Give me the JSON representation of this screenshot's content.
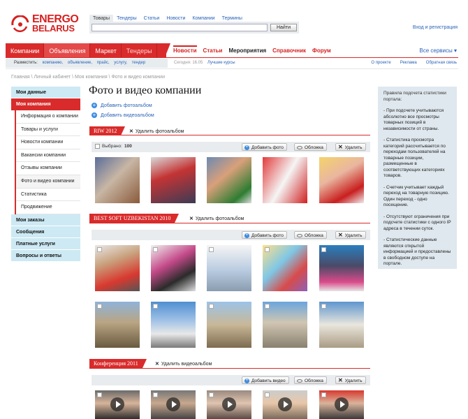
{
  "brand": {
    "line1": "ENERGO",
    "line2": "BELARUS",
    "color": "#d62121"
  },
  "search": {
    "tabs": [
      "Товары",
      "Тендеры",
      "Статьи",
      "Новости",
      "Компании",
      "Термины"
    ],
    "active_tab": "Товары",
    "placeholder": "",
    "button": "Найти"
  },
  "login_link": "Вход и регистрация",
  "nav": {
    "main": [
      "Компании",
      "Объявления",
      "Маркет",
      "Тендеры"
    ],
    "sub": [
      "Новости",
      "Статьи",
      "Мероприятия",
      "Справочник",
      "Форум"
    ],
    "all_services": "Все сервисы ▾"
  },
  "place_bar": {
    "label": "Разместить:",
    "links": [
      "компанию,",
      "объявление,",
      "прайс,",
      "услугу,",
      "тендер"
    ]
  },
  "today": "Сегодня: 16.05",
  "best_rates": "Лучшие курсы",
  "top_links": [
    "О проекте",
    "Реклама",
    "Обратная связь"
  ],
  "breadcrumb": "Главная \\ Личный кабинет \\ Моя компания \\ Фото и видео компании",
  "sidebar": {
    "my_data": "Мои данные",
    "my_company": "Моя компания",
    "company_items": [
      "Информация о компании",
      "Товары и услуги",
      "Новости компании",
      "Вакансии компании",
      "Отзывы компании",
      "Фото и видео компании",
      "Статистика",
      "Продвижение"
    ],
    "bottom": [
      "Мои заказы",
      "Сообщения",
      "Платные услуги",
      "Вопросы и ответы"
    ]
  },
  "page_title": "Фото и видео компании",
  "add_photo_album": "Добавить фотоальбом",
  "add_video_album": "Добавить видеоальбом",
  "albums": [
    {
      "name": "RIW 2012",
      "delete": "Удалить фотоальбом",
      "selected": "Выбрано:",
      "selected_count": "100",
      "add": "Добавить фото",
      "cover": "Обложка",
      "remove": "Удалить"
    },
    {
      "name": "BEST SOFT UZBEKISTAN 2010",
      "delete": "Удалить фотоальбом",
      "add": "Добавить фото",
      "cover": "Обложка",
      "remove": "Удалить"
    },
    {
      "name": "Конференция 2011",
      "delete": "Удалить видеоальбом",
      "add": "Добавить видео",
      "cover": "Обложка",
      "remove": "Удалить"
    }
  ],
  "rules": {
    "title": "Правила подсчета статистики портала:",
    "items": [
      "- При подсчете учитываются абсолютно все просмотры товарных позиций в независимости от страны.",
      "- Статистика просмотра категорий рассчитывается по переходам пользователей на товарные позиции, размещенные в соответствующих категориях товаров.",
      "- Счетчик учитывает каждый переход на товарную позицию. Один переход - одно посещение.",
      "- Отсутствуют ограничения при подсчете статистики с одного IP адреса в течении суток.",
      "- Статистические данные являются открытой информацией и предоставлены в свободном доступе на портале."
    ]
  }
}
